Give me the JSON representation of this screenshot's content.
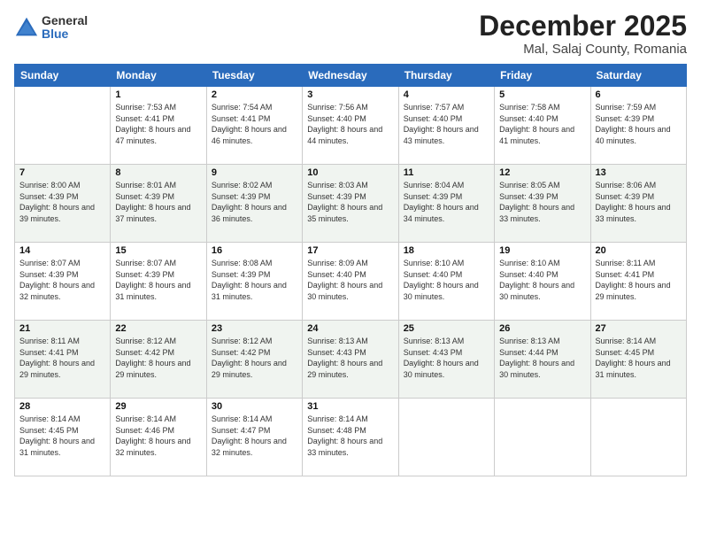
{
  "logo": {
    "general": "General",
    "blue": "Blue"
  },
  "header": {
    "month": "December 2025",
    "location": "Mal, Salaj County, Romania"
  },
  "weekdays": [
    "Sunday",
    "Monday",
    "Tuesday",
    "Wednesday",
    "Thursday",
    "Friday",
    "Saturday"
  ],
  "weeks": [
    [
      {
        "day": "",
        "sunrise": "",
        "sunset": "",
        "daylight": ""
      },
      {
        "day": "1",
        "sunrise": "Sunrise: 7:53 AM",
        "sunset": "Sunset: 4:41 PM",
        "daylight": "Daylight: 8 hours and 47 minutes."
      },
      {
        "day": "2",
        "sunrise": "Sunrise: 7:54 AM",
        "sunset": "Sunset: 4:41 PM",
        "daylight": "Daylight: 8 hours and 46 minutes."
      },
      {
        "day": "3",
        "sunrise": "Sunrise: 7:56 AM",
        "sunset": "Sunset: 4:40 PM",
        "daylight": "Daylight: 8 hours and 44 minutes."
      },
      {
        "day": "4",
        "sunrise": "Sunrise: 7:57 AM",
        "sunset": "Sunset: 4:40 PM",
        "daylight": "Daylight: 8 hours and 43 minutes."
      },
      {
        "day": "5",
        "sunrise": "Sunrise: 7:58 AM",
        "sunset": "Sunset: 4:40 PM",
        "daylight": "Daylight: 8 hours and 41 minutes."
      },
      {
        "day": "6",
        "sunrise": "Sunrise: 7:59 AM",
        "sunset": "Sunset: 4:39 PM",
        "daylight": "Daylight: 8 hours and 40 minutes."
      }
    ],
    [
      {
        "day": "7",
        "sunrise": "Sunrise: 8:00 AM",
        "sunset": "Sunset: 4:39 PM",
        "daylight": "Daylight: 8 hours and 39 minutes."
      },
      {
        "day": "8",
        "sunrise": "Sunrise: 8:01 AM",
        "sunset": "Sunset: 4:39 PM",
        "daylight": "Daylight: 8 hours and 37 minutes."
      },
      {
        "day": "9",
        "sunrise": "Sunrise: 8:02 AM",
        "sunset": "Sunset: 4:39 PM",
        "daylight": "Daylight: 8 hours and 36 minutes."
      },
      {
        "day": "10",
        "sunrise": "Sunrise: 8:03 AM",
        "sunset": "Sunset: 4:39 PM",
        "daylight": "Daylight: 8 hours and 35 minutes."
      },
      {
        "day": "11",
        "sunrise": "Sunrise: 8:04 AM",
        "sunset": "Sunset: 4:39 PM",
        "daylight": "Daylight: 8 hours and 34 minutes."
      },
      {
        "day": "12",
        "sunrise": "Sunrise: 8:05 AM",
        "sunset": "Sunset: 4:39 PM",
        "daylight": "Daylight: 8 hours and 33 minutes."
      },
      {
        "day": "13",
        "sunrise": "Sunrise: 8:06 AM",
        "sunset": "Sunset: 4:39 PM",
        "daylight": "Daylight: 8 hours and 33 minutes."
      }
    ],
    [
      {
        "day": "14",
        "sunrise": "Sunrise: 8:07 AM",
        "sunset": "Sunset: 4:39 PM",
        "daylight": "Daylight: 8 hours and 32 minutes."
      },
      {
        "day": "15",
        "sunrise": "Sunrise: 8:07 AM",
        "sunset": "Sunset: 4:39 PM",
        "daylight": "Daylight: 8 hours and 31 minutes."
      },
      {
        "day": "16",
        "sunrise": "Sunrise: 8:08 AM",
        "sunset": "Sunset: 4:39 PM",
        "daylight": "Daylight: 8 hours and 31 minutes."
      },
      {
        "day": "17",
        "sunrise": "Sunrise: 8:09 AM",
        "sunset": "Sunset: 4:40 PM",
        "daylight": "Daylight: 8 hours and 30 minutes."
      },
      {
        "day": "18",
        "sunrise": "Sunrise: 8:10 AM",
        "sunset": "Sunset: 4:40 PM",
        "daylight": "Daylight: 8 hours and 30 minutes."
      },
      {
        "day": "19",
        "sunrise": "Sunrise: 8:10 AM",
        "sunset": "Sunset: 4:40 PM",
        "daylight": "Daylight: 8 hours and 30 minutes."
      },
      {
        "day": "20",
        "sunrise": "Sunrise: 8:11 AM",
        "sunset": "Sunset: 4:41 PM",
        "daylight": "Daylight: 8 hours and 29 minutes."
      }
    ],
    [
      {
        "day": "21",
        "sunrise": "Sunrise: 8:11 AM",
        "sunset": "Sunset: 4:41 PM",
        "daylight": "Daylight: 8 hours and 29 minutes."
      },
      {
        "day": "22",
        "sunrise": "Sunrise: 8:12 AM",
        "sunset": "Sunset: 4:42 PM",
        "daylight": "Daylight: 8 hours and 29 minutes."
      },
      {
        "day": "23",
        "sunrise": "Sunrise: 8:12 AM",
        "sunset": "Sunset: 4:42 PM",
        "daylight": "Daylight: 8 hours and 29 minutes."
      },
      {
        "day": "24",
        "sunrise": "Sunrise: 8:13 AM",
        "sunset": "Sunset: 4:43 PM",
        "daylight": "Daylight: 8 hours and 29 minutes."
      },
      {
        "day": "25",
        "sunrise": "Sunrise: 8:13 AM",
        "sunset": "Sunset: 4:43 PM",
        "daylight": "Daylight: 8 hours and 30 minutes."
      },
      {
        "day": "26",
        "sunrise": "Sunrise: 8:13 AM",
        "sunset": "Sunset: 4:44 PM",
        "daylight": "Daylight: 8 hours and 30 minutes."
      },
      {
        "day": "27",
        "sunrise": "Sunrise: 8:14 AM",
        "sunset": "Sunset: 4:45 PM",
        "daylight": "Daylight: 8 hours and 31 minutes."
      }
    ],
    [
      {
        "day": "28",
        "sunrise": "Sunrise: 8:14 AM",
        "sunset": "Sunset: 4:45 PM",
        "daylight": "Daylight: 8 hours and 31 minutes."
      },
      {
        "day": "29",
        "sunrise": "Sunrise: 8:14 AM",
        "sunset": "Sunset: 4:46 PM",
        "daylight": "Daylight: 8 hours and 32 minutes."
      },
      {
        "day": "30",
        "sunrise": "Sunrise: 8:14 AM",
        "sunset": "Sunset: 4:47 PM",
        "daylight": "Daylight: 8 hours and 32 minutes."
      },
      {
        "day": "31",
        "sunrise": "Sunrise: 8:14 AM",
        "sunset": "Sunset: 4:48 PM",
        "daylight": "Daylight: 8 hours and 33 minutes."
      },
      {
        "day": "",
        "sunrise": "",
        "sunset": "",
        "daylight": ""
      },
      {
        "day": "",
        "sunrise": "",
        "sunset": "",
        "daylight": ""
      },
      {
        "day": "",
        "sunrise": "",
        "sunset": "",
        "daylight": ""
      }
    ]
  ]
}
